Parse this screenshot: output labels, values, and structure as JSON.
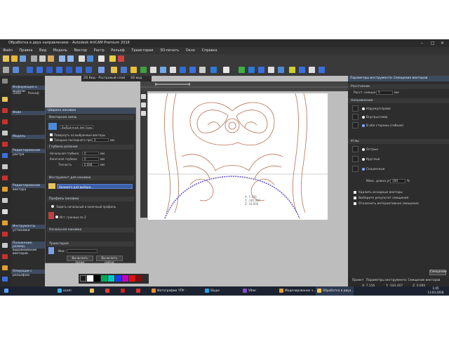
{
  "window": {
    "title": "Обработка в двух направлениях - Autodesk ArtCAM Premium 2018"
  },
  "menu": [
    "Файл",
    "Правка",
    "Вид",
    "Модель",
    "Вектор",
    "Растр",
    "Рельеф",
    "Траектории",
    "3D-печать",
    "Окно",
    "Справка"
  ],
  "view_tabs": [
    "2D Вид - Растровый слой",
    "3D вид"
  ],
  "left_panel": {
    "model_info": {
      "header": "Информация о модели",
      "name_label": "Эскиз",
      "relief_label": "Рельеф"
    },
    "sections": [
      "Файл",
      "Модель",
      "Редактирование растра",
      "Редактирование вектора",
      "Инструменты установки",
      "Положение, размер, выравнивание векторов",
      "Операции с рельефом"
    ]
  },
  "dialog": {
    "title": "Ширина канавки",
    "section_vector": "Векторная связь",
    "select_label": "Выбранные векторы",
    "checkbox1": "Повернуть на выбранные векторы",
    "checkbox2": "Толщина последнего прохода",
    "checkbox2_value": "0",
    "checkbox2_unit": "мм",
    "section_depth": "Глубина резания",
    "start_depth_label": "Начальная глубина",
    "start_depth_value": "0",
    "end_depth_label": "Конечная глубина",
    "end_depth_value": "0",
    "tolerance_label": "Точность",
    "tolerance_value": "0.008",
    "unit": "мм",
    "section_tool": "Инструмент для канавок",
    "tool_select": "Нажмите для выбора...",
    "section_profile": "Профиль канавки",
    "profile_option1": "Задать начальный и конечный профиль",
    "profile_option2": "Ист. граница по 2",
    "section_start": "Начальная канавка",
    "section_toolpath": "Траектория",
    "name_label": "Имя:",
    "btn_now": "Вычислить позже",
    "btn_later": "Вычислить сейчас"
  },
  "right_panel": {
    "header": "Параметры инструмента: Смещение векторов",
    "section_distance": "Расстояние",
    "distance_label": "Расст. смещения:",
    "distance_value": "5",
    "distance_unit": "мм",
    "section_direction": "Направление",
    "dir_outward": "Наружу/справа",
    "dir_inward": "Внутрь/слева",
    "dir_both": "В обе стороны (гибкие)",
    "section_corners": "Углы",
    "corner_sharp": "Острые",
    "corner_round": "Круглые",
    "corner_chamfer": "Скошенные",
    "max_angle_label": "Макс. длина угла:",
    "max_angle_value": "180",
    "max_angle_unit": "%",
    "opt1": "Удалить исходные векторы",
    "opt2": "Выберите результат смещения",
    "opt3": "Отключить интерактивное смещение",
    "apply_button": "Смещение",
    "tabs": [
      "Проект",
      "Параметры инструмента: Смещение векторов"
    ]
  },
  "canvas": {
    "coords": [
      "X: 7.156",
      "Y: -181.407",
      "Z: 16.000"
    ]
  },
  "status": {
    "x": "X: 7.156",
    "y": "Y: -181.407",
    "z": "Z: 0.000"
  },
  "swatches": [
    "#1a1a1a",
    "#ffffff",
    "#000000",
    "#00aa55",
    "#00c8c8",
    "#1b3cff",
    "#c000c0",
    "#e01010",
    "#7a1010"
  ],
  "taskbar": {
    "items": [
      "ocam",
      "",
      "",
      "",
      "Фотографии ЧПУ -",
      "Skype",
      "Viber",
      "Моделирование ч...",
      "Обработка в двух..."
    ],
    "time": "1:45",
    "date": "13.03.2018"
  },
  "colors": {
    "accent": "#3e4b5e",
    "toolpath": "#b5704f",
    "vector": "#6b5bc4"
  }
}
